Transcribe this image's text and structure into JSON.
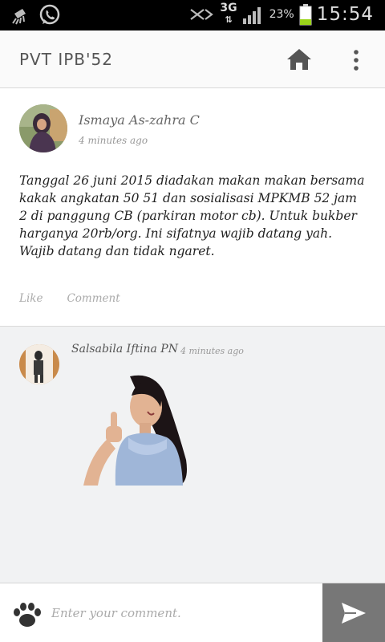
{
  "statusbar": {
    "signal_type": "3G",
    "battery_pct": "23%",
    "time": "15:54"
  },
  "toolbar": {
    "title": "PVT IPB'52",
    "home_icon": "home-icon",
    "more_icon": "more-vert-icon"
  },
  "post": {
    "author": "Ismaya As-zahra C",
    "time": "4 minutes ago",
    "body": "Tanggal 26 juni 2015 diadakan makan makan bersama kakak angkatan 50 51 dan sosialisasi MPKMB 52 jam 2 di panggung CB (parkiran motor cb). Untuk bukber harganya 20rb/org. Ini sifatnya wajib datang yah. Wajib datang dan tidak ngaret.",
    "like_label": "Like",
    "comment_label": "Comment"
  },
  "comments": [
    {
      "author": "Salsabila Iftina PN",
      "time": "4 minutes ago",
      "type": "sticker"
    }
  ],
  "input": {
    "placeholder": "Enter your comment."
  },
  "colors": {
    "statusbar": "#000000",
    "toolbar": "#fafafa",
    "comments_bg": "#f1f2f3",
    "send_bg": "#777777",
    "battery": "#9bd41a"
  }
}
